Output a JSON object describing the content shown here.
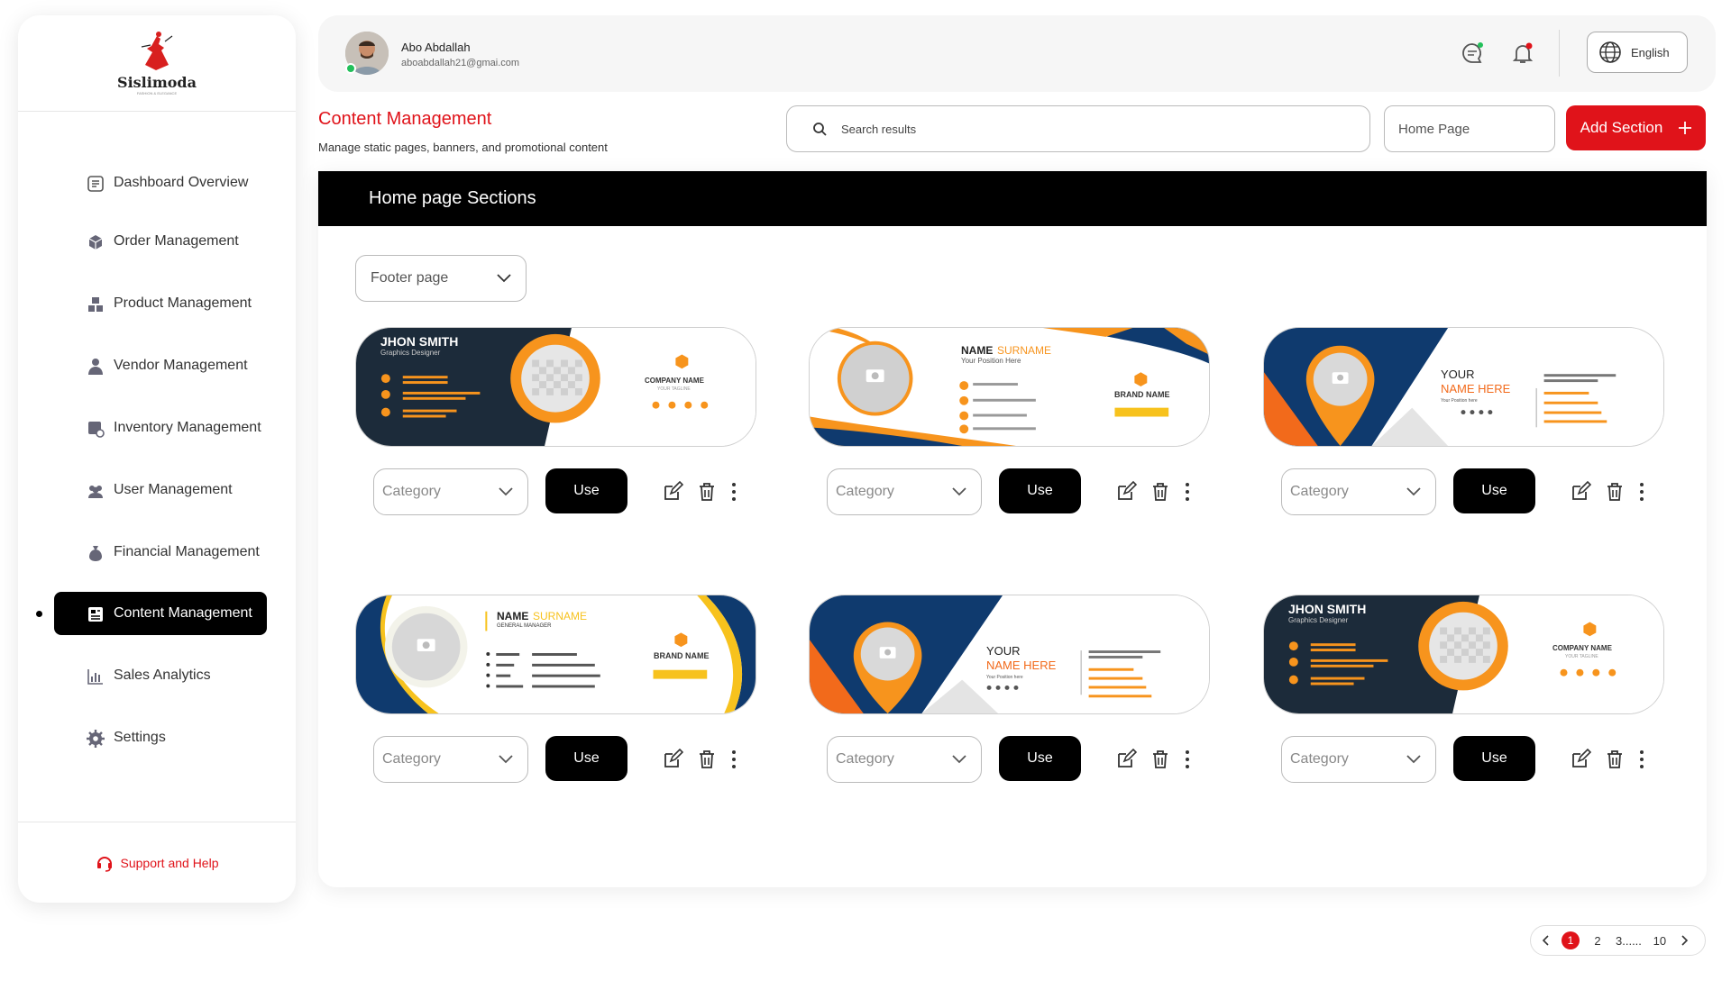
{
  "brand": {
    "name": "Sislimoda",
    "tagline": "FASHION & ELEGANCE"
  },
  "sidebar": {
    "items": [
      {
        "label": "Dashboard Overview",
        "icon": "dashboard-icon"
      },
      {
        "label": "Order Management",
        "icon": "box-icon"
      },
      {
        "label": "Product Management",
        "icon": "boxes-icon"
      },
      {
        "label": "Vendor Management",
        "icon": "vendor-icon"
      },
      {
        "label": "Inventory Management",
        "icon": "inventory-icon"
      },
      {
        "label": "User Management",
        "icon": "users-icon"
      },
      {
        "label": "Financial Management",
        "icon": "money-bag-icon"
      },
      {
        "label": "Content Management",
        "icon": "content-icon",
        "active": true
      },
      {
        "label": "Sales Analytics",
        "icon": "chart-icon"
      },
      {
        "label": "Settings",
        "icon": "gear-icon"
      }
    ],
    "support_label": "Support and Help"
  },
  "topbar": {
    "user_name": "Abo Abdallah",
    "user_email": "aboabdallah21@gmai.com",
    "language": "English"
  },
  "header": {
    "title": "Content Management",
    "subtitle": "Manage static pages, banners, and promotional content",
    "search_placeholder": "Search results",
    "page_select": "Home Page",
    "add_label": "Add Section"
  },
  "main": {
    "section_title": "Home page Sections",
    "filter_value": "Footer page",
    "tiles": [
      {
        "category_placeholder": "Category",
        "use_label": "Use",
        "design": "jhon-smith-dark",
        "name": "JHON SMITH",
        "role": "Graphics Designer",
        "company": "COMPANY NAME",
        "tagline": "YOUR TAGLINE"
      },
      {
        "category_placeholder": "Category",
        "use_label": "Use",
        "design": "name-surname-wave",
        "name": "NAME",
        "surname": "SURNAME",
        "role": "Your Position Here",
        "company": "BRAND NAME"
      },
      {
        "category_placeholder": "Category",
        "use_label": "Use",
        "design": "your-name-pin",
        "name1": "YOUR",
        "name2": "NAME HERE",
        "role": "Your Position here"
      },
      {
        "category_placeholder": "Category",
        "use_label": "Use",
        "design": "name-surname-blue",
        "name": "NAME",
        "surname": "SURNAME",
        "role": "GENERAL MANAGER",
        "company": "BRAND NAME"
      },
      {
        "category_placeholder": "Category",
        "use_label": "Use",
        "design": "your-name-pin",
        "name1": "YOUR",
        "name2": "NAME HERE",
        "role": "Your Position here"
      },
      {
        "category_placeholder": "Category",
        "use_label": "Use",
        "design": "jhon-smith-dark",
        "name": "JHON SMITH",
        "role": "Graphics Designer",
        "company": "COMPANY NAME",
        "tagline": "YOUR TAGLINE"
      }
    ]
  },
  "pagination": {
    "pages": [
      "1",
      "2",
      "3......",
      "10"
    ],
    "current": "1"
  },
  "colors": {
    "accent": "#e0131a",
    "navy": "#1b2a3a",
    "orange": "#f7941d",
    "blue": "#0f3a6e"
  }
}
